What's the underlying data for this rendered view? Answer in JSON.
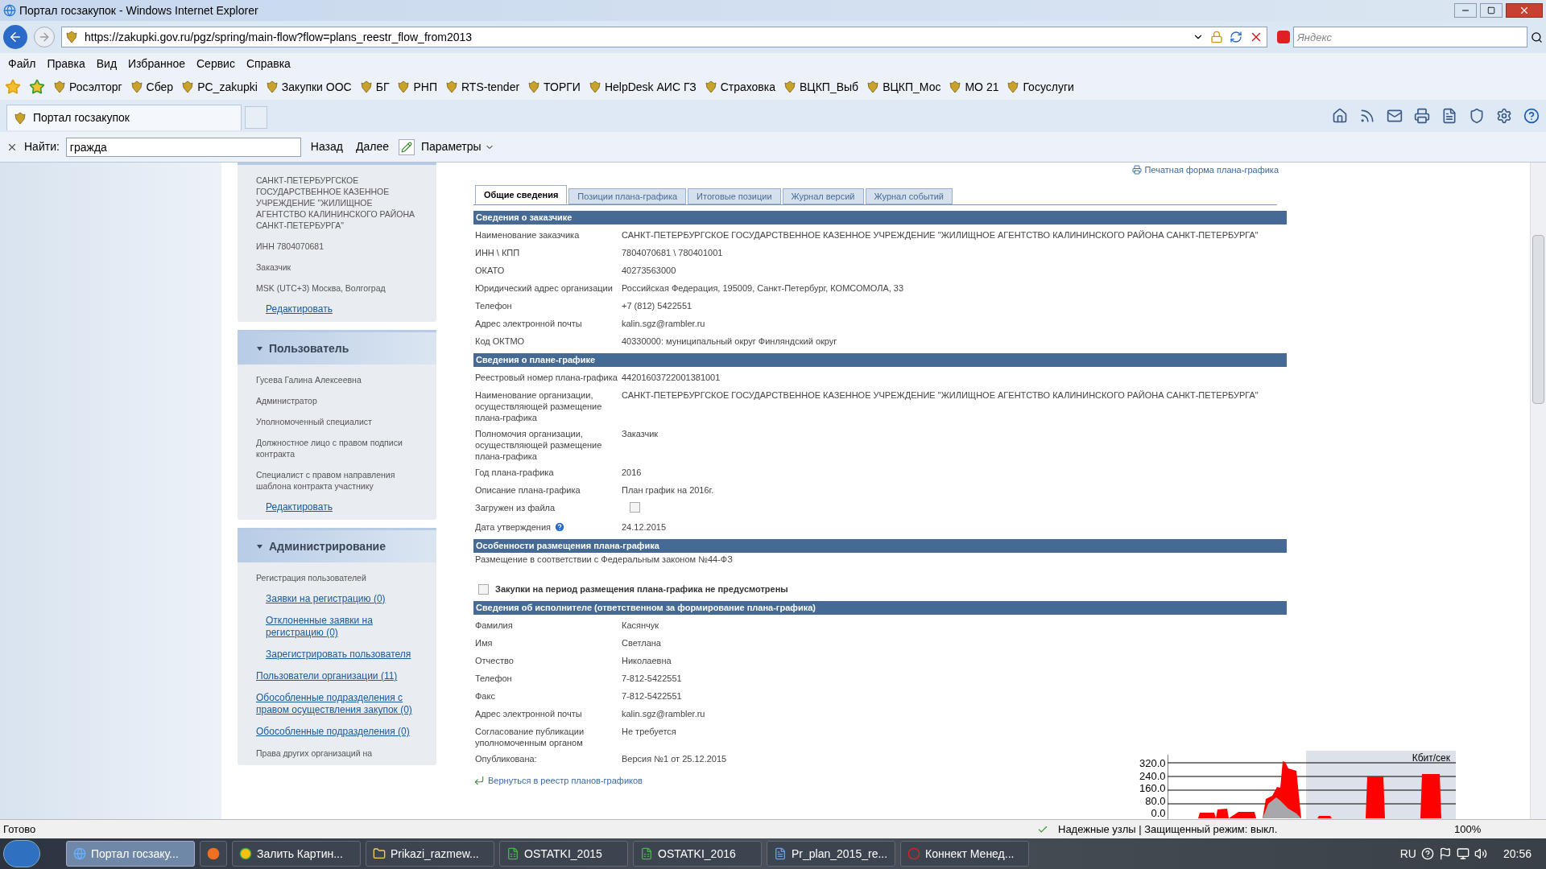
{
  "window": {
    "title": "Портал госзакупок - Windows Internet Explorer"
  },
  "address_bar": {
    "url": "https://zakupki.gov.ru/pgz/spring/main-flow?flow=plans_reestr_flow_from2013",
    "search_placeholder": "Яндекс"
  },
  "menu": [
    "Файл",
    "Правка",
    "Вид",
    "Избранное",
    "Сервис",
    "Справка"
  ],
  "favorites": [
    {
      "label": "Росэлторг"
    },
    {
      "label": "Сбер"
    },
    {
      "label": "PC_zakupki"
    },
    {
      "label": "Закупки ООС"
    },
    {
      "label": "БГ"
    },
    {
      "label": "РНП"
    },
    {
      "label": "RTS-tender"
    },
    {
      "label": "ТОРГИ"
    },
    {
      "label": "HelpDesk АИС ГЗ"
    },
    {
      "label": "Страховка"
    },
    {
      "label": "ВЦКП_Выб"
    },
    {
      "label": "ВЦКП_Мос"
    },
    {
      "label": "МО 21"
    },
    {
      "label": "Госуслуги"
    }
  ],
  "browser_tab": {
    "title": "Портал госзакупок"
  },
  "find_bar": {
    "label": "Найти:",
    "value": "гражда",
    "buttons": [
      "Назад",
      "Далее"
    ],
    "options": "Параметры"
  },
  "sidebar": [
    {
      "items": [
        {
          "kind": "text",
          "text": "САНКТ-ПЕТЕРБУРГСКОЕ ГОСУДАРСТВЕННОЕ КАЗЕННОЕ УЧРЕЖДЕНИЕ \"ЖИЛИЩНОЕ АГЕНТСТВО КАЛИНИНСКОГО РАЙОНА САНКТ-ПЕТЕРБУРГА\""
        },
        {
          "kind": "text",
          "text": "ИНН 7804070681"
        },
        {
          "kind": "text",
          "text": "Заказчик"
        },
        {
          "kind": "text",
          "text": "MSK (UTC+3) Москва, Волгоград"
        },
        {
          "kind": "sublink",
          "text": "Редактировать"
        }
      ]
    },
    {
      "title": "Пользователь",
      "items": [
        {
          "kind": "text",
          "text": "Гусева Галина Алексеевна"
        },
        {
          "kind": "text",
          "text": "Администратор"
        },
        {
          "kind": "text",
          "text": "Уполномоченный специалист"
        },
        {
          "kind": "text",
          "text": "Должностное лицо с правом подписи контракта"
        },
        {
          "kind": "text",
          "text": "Специалист с правом направления шаблона контракта участнику"
        },
        {
          "kind": "sublink",
          "text": "Редактировать"
        }
      ]
    },
    {
      "title": "Администрирование",
      "items": [
        {
          "kind": "text",
          "text": "Регистрация пользователей"
        },
        {
          "kind": "sublink",
          "text": "Заявки на регистрацию (0)"
        },
        {
          "kind": "sublink",
          "text": "Отклоненные заявки на регистрацию (0)"
        },
        {
          "kind": "sublink",
          "text": "Зарегистрировать пользователя"
        },
        {
          "kind": "link",
          "text": "Пользователи организации (11)"
        },
        {
          "kind": "link",
          "text": "Обособленные подразделения с правом осуществления закупок (0)"
        },
        {
          "kind": "link",
          "text": "Обособленные подразделения (0)"
        },
        {
          "kind": "text",
          "text": "Права других организаций на"
        }
      ]
    }
  ],
  "print_link": "Печатная форма плана-графика",
  "tabs": [
    {
      "label": "Общие сведения",
      "selected": true
    },
    {
      "label": "Позиции плана-графика",
      "selected": false
    },
    {
      "label": "Итоговые позиции",
      "selected": false
    },
    {
      "label": "Журнал версий",
      "selected": false
    },
    {
      "label": "Журнал событий",
      "selected": false
    }
  ],
  "sections": [
    {
      "kind": "table",
      "title": "Сведения о заказчике",
      "rows": [
        {
          "kind": "text",
          "label": "Наименование заказчика",
          "value": "САНКТ-ПЕТЕРБУРГСКОЕ ГОСУДАРСТВЕННОЕ КАЗЕННОЕ УЧРЕЖДЕНИЕ \"ЖИЛИЩНОЕ АГЕНТСТВО КАЛИНИНСКОГО РАЙОНА САНКТ-ПЕТЕРБУРГА\""
        },
        {
          "kind": "text",
          "label": "ИНН \\ КПП",
          "value": "7804070681 \\ 780401001"
        },
        {
          "kind": "text",
          "label": "ОКАТО",
          "value": "40273563000"
        },
        {
          "kind": "text",
          "label": "Юридический адрес организации",
          "value": "Российская Федерация, 195009, Санкт-Петербург, КОМСОМОЛА, 33"
        },
        {
          "kind": "text",
          "label": "Телефон",
          "value": "+7 (812) 5422551"
        },
        {
          "kind": "text",
          "label": "Адрес электронной почты",
          "value": "kalin.sgz@rambler.ru"
        },
        {
          "kind": "text",
          "label": "Код ОКТМО",
          "value": "40330000: муниципальный округ Финляндский округ"
        }
      ]
    },
    {
      "kind": "table",
      "title": "Сведения о плане-графике",
      "rows": [
        {
          "kind": "text",
          "label": "Реестровый номер плана-графика",
          "value": "44201603722001381001"
        },
        {
          "kind": "text",
          "label": "Наименование организации, осуществляющей размещение плана-графика",
          "value": "САНКТ-ПЕТЕРБУРГСКОЕ ГОСУДАРСТВЕННОЕ КАЗЕННОЕ УЧРЕЖДЕНИЕ \"ЖИЛИЩНОЕ АГЕНТСТВО КАЛИНИНСКОГО РАЙОНА САНКТ-ПЕТЕРБУРГА\""
        },
        {
          "kind": "text",
          "label": "Полномочия организации, осуществляющей размещение плана-графика",
          "value": "Заказчик"
        },
        {
          "kind": "text",
          "label": "Год плана-графика",
          "value": "2016"
        },
        {
          "kind": "text",
          "label": "Описание плана-графика",
          "value": "План график на 2016г."
        },
        {
          "kind": "checkbox",
          "label": "Загружен из файла",
          "checked": false
        },
        {
          "kind": "help",
          "label": "Дата утверждения",
          "value": "24.12.2015"
        }
      ]
    },
    {
      "kind": "note",
      "title": "Особенности размещения плана-графика",
      "note": "Размещение в соответствии с Федеральным законом №44-ФЗ",
      "option": {
        "label": "Закупки на период размещения плана-графика не предусмотрены",
        "checked": false
      }
    },
    {
      "kind": "table",
      "title": "Сведения об исполнителе (ответственном за формирование плана-графика)",
      "rows": [
        {
          "kind": "text",
          "label": "Фамилия",
          "value": "Касянчук"
        },
        {
          "kind": "text",
          "label": "Имя",
          "value": "Светлана"
        },
        {
          "kind": "text",
          "label": "Отчество",
          "value": "Николаевна"
        },
        {
          "kind": "text",
          "label": "Телефон",
          "value": "7-812-5422551"
        },
        {
          "kind": "text",
          "label": "Факс",
          "value": "7-812-5422551"
        },
        {
          "kind": "text",
          "label": "Адрес электронной почты",
          "value": "kalin.sgz@rambler.ru"
        },
        {
          "kind": "text",
          "label": "Согласование публикации уполномоченным органом",
          "value": "Не требуется"
        },
        {
          "kind": "text",
          "label": "Опубликована:",
          "value": "Версия №1 от 25.12.2015"
        }
      ]
    }
  ],
  "back_link": "Вернуться в реестр планов-графиков",
  "network_meter": {
    "unit": "Кбит/сек",
    "ticks": [
      "320.0",
      "240.0",
      "160.0",
      "80.0",
      "0.0"
    ]
  },
  "status_bar": {
    "text": "Готово",
    "zone": "Надежные узлы | Защищенный режим: выкл.",
    "zoom": "100%"
  },
  "taskbar": {
    "items": [
      {
        "label": "Портал госзаку...",
        "kind": "browser",
        "selected": true
      },
      {
        "kind": "fox",
        "selected": false
      },
      {
        "label": "Залить Картин...",
        "kind": "chrome",
        "selected": false
      },
      {
        "label": "Prikazi_razmew...",
        "kind": "folder",
        "selected": false
      },
      {
        "label": "OSTATKI_2015",
        "kind": "sheet",
        "selected": false
      },
      {
        "label": "OSTATKI_2016",
        "kind": "sheet",
        "selected": false
      },
      {
        "label": "Pr_plan_2015_re...",
        "kind": "document",
        "selected": false
      },
      {
        "label": "Коннект Менед...",
        "kind": "ring",
        "selected": false
      }
    ],
    "language": "RU",
    "clock": "20:56"
  }
}
